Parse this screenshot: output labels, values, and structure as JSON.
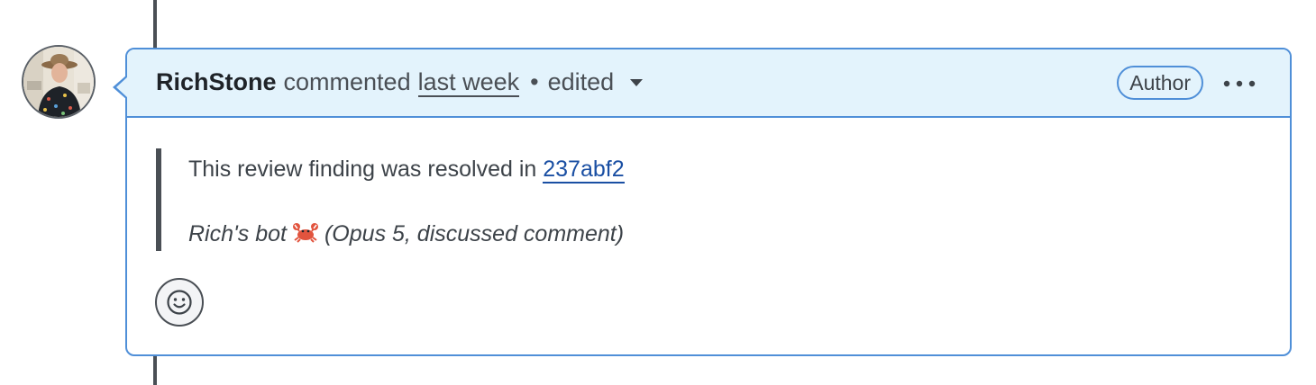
{
  "comment": {
    "author": "RichStone",
    "action": "commented",
    "time": "last week",
    "separator": "•",
    "edited": "edited",
    "badge": "Author",
    "body": {
      "line1_text": "This review finding was resolved in",
      "commit_link": "237abf2",
      "line2_prefix": "Rich's bot",
      "line2_suffix": "(Opus 5, discussed comment)"
    }
  },
  "icons": {
    "more": "kebab-horizontal-icon",
    "caret": "triangle-down-icon",
    "reaction": "smiley-icon",
    "crab": "crab-emoji"
  },
  "colors": {
    "header_bg": "#e3f3fc",
    "border_accent": "#4f8fd8",
    "link": "#1a4fa3",
    "timeline": "#4a4f55"
  }
}
